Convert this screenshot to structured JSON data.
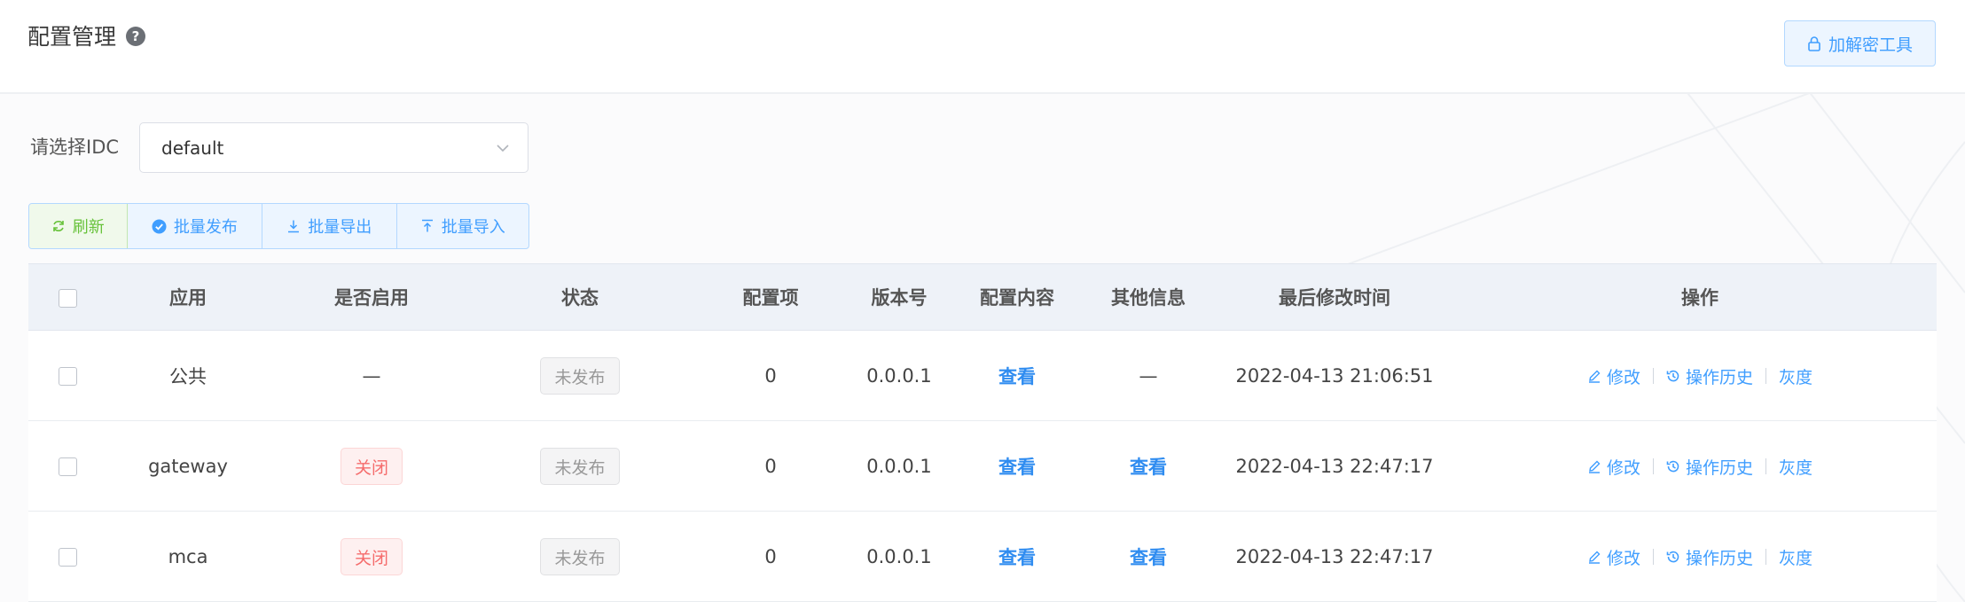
{
  "header": {
    "title": "配置管理",
    "help_glyph": "?",
    "tool_button_label": "加解密工具"
  },
  "idc": {
    "label": "请选择IDC",
    "selected": "default"
  },
  "toolbar": {
    "refresh_label": "刷新",
    "publish_label": "批量发布",
    "export_label": "批量导出",
    "import_label": "批量导入"
  },
  "table": {
    "columns": [
      "应用",
      "是否启用",
      "状态",
      "配置项",
      "版本号",
      "配置内容",
      "其他信息",
      "最后修改时间",
      "操作"
    ],
    "rows": [
      {
        "app": "公共",
        "enabled": "—",
        "status": "未发布",
        "items": "0",
        "version": "0.0.0.1",
        "content": "查看",
        "other": "—",
        "modified": "2022-04-13 21:06:51",
        "op_edit": "修改",
        "op_history": "操作历史",
        "op_gray": "灰度"
      },
      {
        "app": "gateway",
        "enabled": "关闭",
        "status": "未发布",
        "items": "0",
        "version": "0.0.0.1",
        "content": "查看",
        "other": "查看",
        "modified": "2022-04-13 22:47:17",
        "op_edit": "修改",
        "op_history": "操作历史",
        "op_gray": "灰度"
      },
      {
        "app": "mca",
        "enabled": "关闭",
        "status": "未发布",
        "items": "0",
        "version": "0.0.0.1",
        "content": "查看",
        "other": "查看",
        "modified": "2022-04-13 22:47:17",
        "op_edit": "修改",
        "op_history": "操作历史",
        "op_gray": "灰度"
      }
    ]
  },
  "colors": {
    "primary": "#409eff",
    "success": "#67c23a",
    "danger": "#f56c6c",
    "muted": "#999999"
  },
  "icons": [
    "help-icon",
    "lock-icon",
    "chevron-down-icon",
    "refresh-icon",
    "check-circle-icon",
    "download-icon",
    "upload-icon",
    "edit-icon",
    "history-icon"
  ]
}
